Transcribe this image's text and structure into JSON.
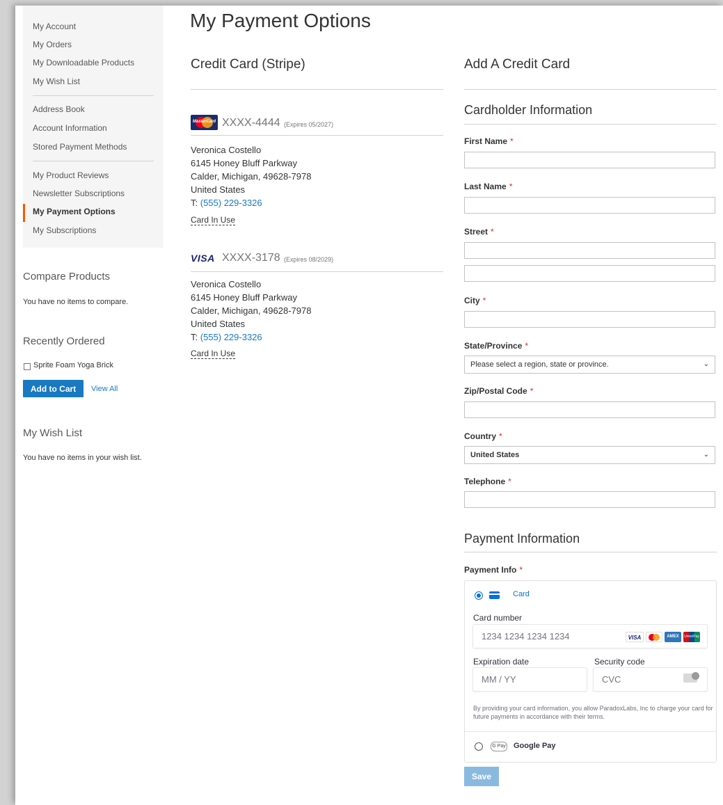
{
  "sidebar": {
    "nav": [
      {
        "label": "My Account"
      },
      {
        "label": "My Orders"
      },
      {
        "label": "My Downloadable Products"
      },
      {
        "label": "My Wish List"
      },
      {
        "label": "Address Book"
      },
      {
        "label": "Account Information"
      },
      {
        "label": "Stored Payment Methods"
      },
      {
        "label": "My Product Reviews"
      },
      {
        "label": "Newsletter Subscriptions"
      },
      {
        "label": "My Payment Options",
        "active": true
      },
      {
        "label": "My Subscriptions"
      }
    ],
    "compare": {
      "title": "Compare Products",
      "empty": "You have no items to compare."
    },
    "recent": {
      "title": "Recently Ordered",
      "item": "Sprite Foam Yoga Brick",
      "add_to_cart": "Add to Cart",
      "view_all": "View All"
    },
    "wishlist": {
      "title": "My Wish List",
      "empty": "You have no items in your wish list."
    }
  },
  "page": {
    "title": "My Payment Options"
  },
  "stored_cards": {
    "section_title": "Credit Card (Stripe)",
    "cards": [
      {
        "brand": "MasterCard",
        "number": "XXXX-4444",
        "expires": "(Expires 05/2027)",
        "name": "Veronica Costello",
        "street": "6145 Honey Bluff Parkway",
        "city_line": "Calder, Michigan, 49628-7978",
        "country": "United States",
        "phone_prefix": "T: ",
        "phone": "(555) 229-3326",
        "status": "Card In Use"
      },
      {
        "brand": "VISA",
        "number": "XXXX-3178",
        "expires": "(Expires 08/2029)",
        "name": "Veronica Costello",
        "street": "6145 Honey Bluff Parkway",
        "city_line": "Calder, Michigan, 49628-7978",
        "country": "United States",
        "phone_prefix": "T: ",
        "phone": "(555) 229-3326",
        "status": "Card In Use"
      }
    ]
  },
  "add_card": {
    "title": "Add A Credit Card",
    "cardholder_title": "Cardholder Information",
    "fields": {
      "first_name": "First Name",
      "last_name": "Last Name",
      "street": "Street",
      "city": "City",
      "state": "State/Province",
      "state_value": "Please select a region, state or province.",
      "zip": "Zip/Postal Code",
      "country": "Country",
      "country_value": "United States",
      "telephone": "Telephone",
      "required_mark": "*"
    },
    "payment_title": "Payment Information",
    "payment_info_label": "Payment Info",
    "stripe": {
      "method_card": "Card",
      "card_number_label": "Card number",
      "card_number_placeholder": "1234 1234 1234 1234",
      "expiration_label": "Expiration date",
      "expiration_placeholder": "MM / YY",
      "security_label": "Security code",
      "security_placeholder": "CVC",
      "terms": "By providing your card information, you allow ParadoxLabs, Inc to charge your card for future payments in accordance with their terms.",
      "gpay_badge": "G Pay",
      "method_gpay": "Google Pay",
      "brand_visa": "VISA",
      "brand_mc_text": "MasterCard",
      "brand_amex": "AMEX",
      "brand_unionpay": "UnionPay"
    },
    "save": "Save"
  },
  "colors": {
    "accent": "#1979c3",
    "nav_active": "#ff5501",
    "required": "#e02b27",
    "stripe_blue": "#0570de"
  }
}
